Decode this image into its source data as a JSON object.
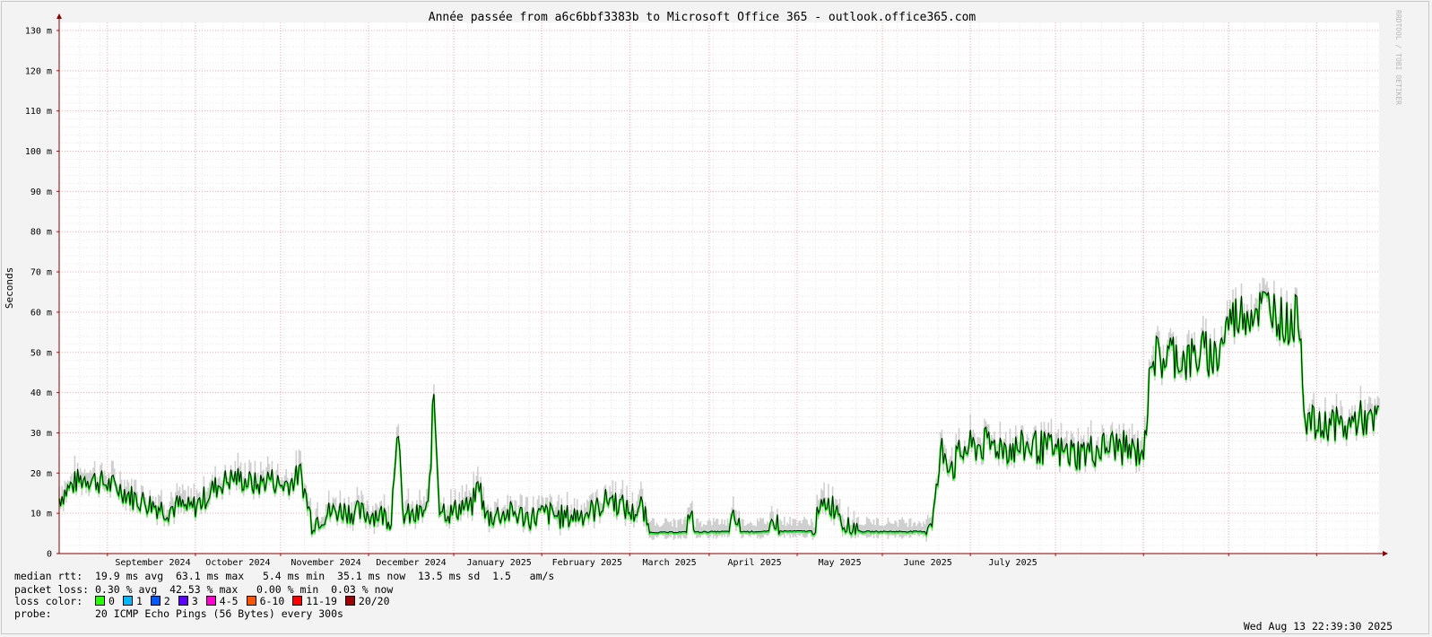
{
  "chart_data": {
    "type": "line",
    "title": "Année passée from a6c6bbf3383b to Microsoft Office 365 - outlook.office365.com",
    "ylabel": "Seconds",
    "side_label": "RRDTOOL / TOBI OETIKER",
    "y_ticks": [
      "0",
      "10 m",
      "20 m",
      "30 m",
      "40 m",
      "50 m",
      "60 m",
      "70 m",
      "80 m",
      "90 m",
      "100 m",
      "110 m",
      "120 m",
      "130 m"
    ],
    "ylim": [
      0,
      132
    ],
    "x_ticks": [
      "September 2024",
      "October 2024",
      "November 2024",
      "December 2024",
      "January 2025",
      "February 2025",
      "March 2025",
      "April 2025",
      "May 2025",
      "June 2025",
      "July 2025"
    ],
    "x_unit": "days since 2024-08-14 (one year, 365 days)",
    "series": [
      {
        "name": "median rtt (ms)",
        "points": [
          [
            0,
            14
          ],
          [
            3,
            16
          ],
          [
            6,
            18
          ],
          [
            10,
            19
          ],
          [
            14,
            18
          ],
          [
            18,
            17
          ],
          [
            22,
            16
          ],
          [
            26,
            14
          ],
          [
            30,
            13
          ],
          [
            34,
            12
          ],
          [
            38,
            11
          ],
          [
            42,
            12
          ],
          [
            46,
            11
          ],
          [
            50,
            13
          ],
          [
            54,
            16
          ],
          [
            58,
            18
          ],
          [
            62,
            19
          ],
          [
            66,
            18
          ],
          [
            70,
            17
          ],
          [
            74,
            19
          ],
          [
            78,
            17
          ],
          [
            82,
            18
          ],
          [
            85,
            20
          ],
          [
            89,
            8
          ],
          [
            94,
            10
          ],
          [
            100,
            11
          ],
          [
            106,
            10
          ],
          [
            112,
            10
          ],
          [
            117,
            9
          ],
          [
            119,
            33
          ],
          [
            121,
            10
          ],
          [
            125,
            9
          ],
          [
            130,
            11
          ],
          [
            132,
            40
          ],
          [
            134,
            12
          ],
          [
            138,
            10
          ],
          [
            142,
            12
          ],
          [
            145,
            11
          ],
          [
            148,
            18
          ],
          [
            150,
            9
          ],
          [
            155,
            10
          ],
          [
            160,
            10
          ],
          [
            166,
            9
          ],
          [
            172,
            10
          ],
          [
            178,
            9
          ],
          [
            184,
            10
          ],
          [
            189,
            11
          ],
          [
            194,
            14
          ],
          [
            198,
            12
          ],
          [
            202,
            10
          ],
          [
            205,
            12
          ],
          [
            208,
            5.3
          ],
          [
            215,
            5.3
          ],
          [
            221,
            5.4
          ],
          [
            222,
            11
          ],
          [
            224,
            5.4
          ],
          [
            236,
            5.5
          ],
          [
            238,
            9
          ],
          [
            240,
            5.5
          ],
          [
            250,
            5.5
          ],
          [
            252,
            9
          ],
          [
            254,
            5.6
          ],
          [
            265,
            5.6
          ],
          [
            270,
            13
          ],
          [
            275,
            11
          ],
          [
            277,
            5.5
          ],
          [
            280,
            7
          ],
          [
            282,
            5.5
          ],
          [
            305,
            5.5
          ],
          [
            306,
            7
          ],
          [
            308,
            10
          ],
          [
            311,
            26
          ],
          [
            315,
            22
          ],
          [
            319,
            26
          ],
          [
            325,
            27
          ],
          [
            331,
            27
          ],
          [
            337,
            26
          ],
          [
            343,
            27
          ],
          [
            348,
            26
          ],
          [
            354,
            25
          ],
          [
            360,
            25
          ],
          [
            366,
            26
          ],
          [
            372,
            27
          ],
          [
            376,
            26
          ],
          [
            379,
            25
          ],
          [
            383,
            27
          ],
          [
            384,
            50
          ],
          [
            388,
            48
          ],
          [
            392,
            50
          ],
          [
            398,
            48
          ],
          [
            403,
            50
          ],
          [
            408,
            49
          ],
          [
            412,
            58
          ],
          [
            417,
            60
          ],
          [
            422,
            61
          ],
          [
            427,
            62
          ],
          [
            432,
            57
          ],
          [
            437,
            59
          ],
          [
            439,
            34
          ],
          [
            444,
            31
          ],
          [
            448,
            33
          ],
          [
            453,
            31
          ],
          [
            458,
            34
          ],
          [
            463,
            32
          ],
          [
            465,
            35
          ]
        ]
      }
    ],
    "legend": {
      "median_rtt": "median rtt:  19.9 ms avg  63.1 ms max   5.4 ms min  35.1 ms now  13.5 ms sd  1.5   am/s",
      "packet_loss": "packet loss: 0.30 % avg  42.53 % max   0.00 % min  0.03 % now",
      "loss_color_label": "loss color:",
      "loss_colors": [
        {
          "label": "0",
          "color": "#26ff00"
        },
        {
          "label": "1",
          "color": "#00b8ff"
        },
        {
          "label": "2",
          "color": "#0059ff"
        },
        {
          "label": "3",
          "color": "#5e00ff"
        },
        {
          "label": "4-5",
          "color": "#ff00d0"
        },
        {
          "label": "6-10",
          "color": "#ff5500"
        },
        {
          "label": "11-19",
          "color": "#ff0000"
        },
        {
          "label": "20/20",
          "color": "#a10000"
        }
      ],
      "probe": "probe:       20 ICMP Echo Pings (56 Bytes) every 300s",
      "timestamp": "Wed Aug 13 22:39:30 2025"
    },
    "grid": true
  }
}
